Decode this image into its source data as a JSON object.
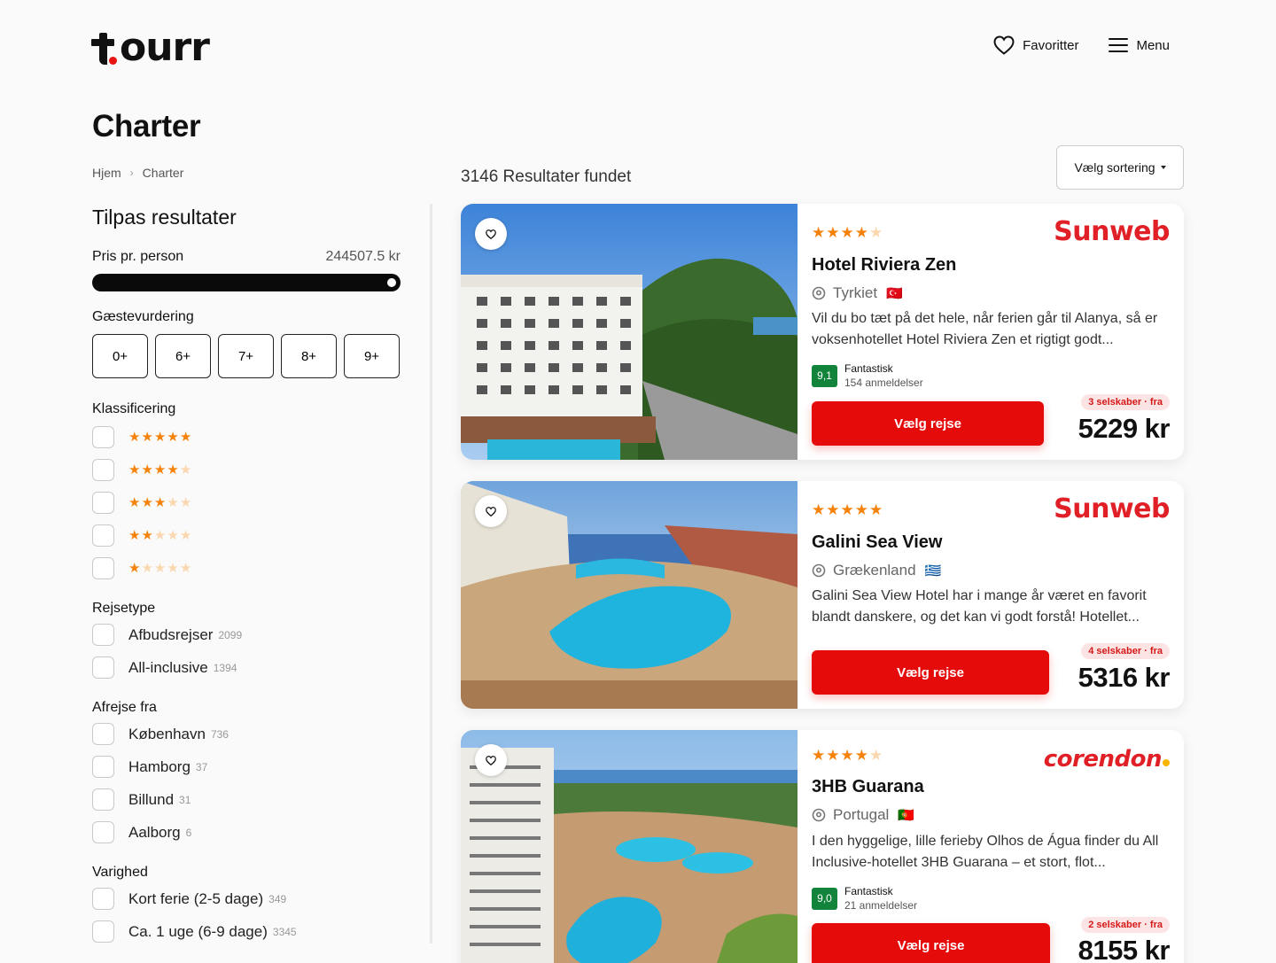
{
  "header": {
    "logo_text": "ourr",
    "favorites_label": "Favoritter",
    "menu_label": "Menu"
  },
  "page": {
    "title": "Charter",
    "breadcrumb": [
      "Hjem",
      "Charter"
    ]
  },
  "filters": {
    "title": "Tilpas resultater",
    "price": {
      "label": "Pris pr. person",
      "value": "244507.5 kr",
      "fill_fraction": 1.0
    },
    "guest_rating": {
      "label": "Gæstevurdering",
      "options": [
        "0+",
        "6+",
        "7+",
        "8+",
        "9+"
      ]
    },
    "classification": {
      "label": "Klassificering",
      "star_options": [
        5,
        4,
        3,
        2,
        1
      ]
    },
    "trip_type": {
      "label": "Rejsetype",
      "items": [
        {
          "label": "Afbudsrejser",
          "count": "2099"
        },
        {
          "label": "All-inclusive",
          "count": "1394"
        }
      ]
    },
    "departure": {
      "label": "Afrejse fra",
      "items": [
        {
          "label": "København",
          "count": "736"
        },
        {
          "label": "Hamborg",
          "count": "37"
        },
        {
          "label": "Billund",
          "count": "31"
        },
        {
          "label": "Aalborg",
          "count": "6"
        }
      ]
    },
    "duration": {
      "label": "Varighed",
      "items": [
        {
          "label": "Kort ferie (2-5 dage)",
          "count": "349"
        },
        {
          "label": "Ca. 1 uge (6-9 dage)",
          "count": "3345"
        }
      ]
    }
  },
  "results": {
    "count_text": "3146 Resultater fundet",
    "sort_label": "Vælg sortering",
    "cards": [
      {
        "stars": 4,
        "brand": "Sunweb",
        "name": "Hotel Riviera Zen",
        "country": "Tyrkiet",
        "flag": "🇹🇷",
        "description": "Vil du bo tæt på det hele, når ferien går til Alanya, så er voksenhotellet Hotel Riviera Zen et rigtigt godt...",
        "score": "9,1",
        "score_label": "Fantastisk",
        "reviews": "154 anmeldelser",
        "button": "Vælg rejse",
        "companies": "3 selskaber · fra",
        "price": "5229 kr"
      },
      {
        "stars": 5,
        "brand": "Sunweb",
        "name": "Galini Sea View",
        "country": "Grækenland",
        "flag": "🇬🇷",
        "description": "Galini Sea View Hotel har i mange år været en favorit blandt danskere, og det kan vi godt forstå! Hotellet...",
        "button": "Vælg rejse",
        "companies": "4 selskaber · fra",
        "price": "5316 kr"
      },
      {
        "stars": 4,
        "brand": "corendon",
        "name": "3HB Guarana",
        "country": "Portugal",
        "flag": "🇵🇹",
        "description": "I den hyggelige, lille ferieby Olhos de Água finder du All Inclusive-hotellet 3HB Guarana – et stort, flot...",
        "score": "9,0",
        "score_label": "Fantastisk",
        "reviews": "21 anmeldelser",
        "button": "Vælg rejse",
        "companies": "2 selskaber · fra",
        "price": "8155 kr"
      }
    ]
  },
  "colors": {
    "accent_red": "#e50b0b",
    "star_orange": "#f5820b",
    "score_green": "#11833b"
  },
  "icons": [
    "heart-icon",
    "hamburger-menu-icon",
    "chevron-right-icon",
    "location-pin-icon",
    "star-icon",
    "caret-down-icon"
  ]
}
